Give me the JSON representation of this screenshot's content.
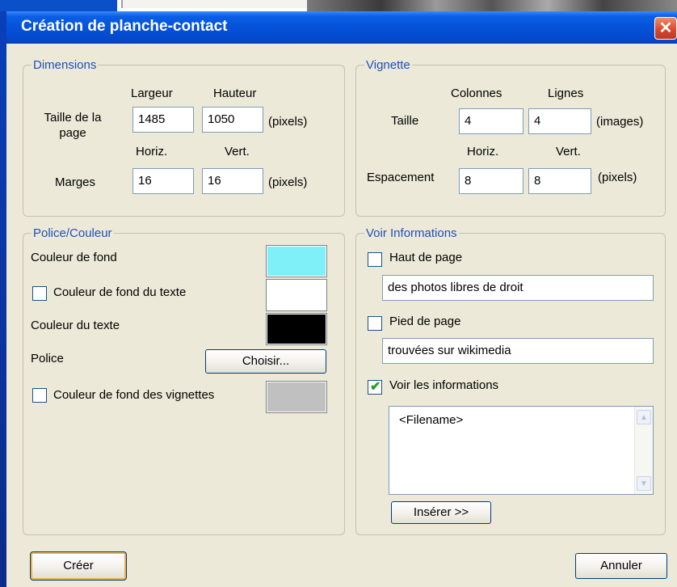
{
  "dialog": {
    "title": "Création de planche-contact",
    "close_icon": "close-icon"
  },
  "dimensions": {
    "legend": "Dimensions",
    "col_width": "Largeur",
    "col_height": "Hauteur",
    "page_size_label_line1": "Taille de la",
    "page_size_label_line2": "page",
    "page_width": "1485",
    "page_height": "1050",
    "units1": "(pixels)",
    "col_horiz": "Horiz.",
    "col_vert": "Vert.",
    "margins_label": "Marges",
    "margin_horiz": "16",
    "margin_vert": "16",
    "units2": "(pixels)"
  },
  "thumbnail": {
    "legend": "Vignette",
    "col_columns": "Colonnes",
    "col_rows": "Lignes",
    "size_label": "Taille",
    "columns": "4",
    "rows": "4",
    "units1": "(images)",
    "col_horiz": "Horiz.",
    "col_vert": "Vert.",
    "spacing_label": "Espacement",
    "spacing_horiz": "8",
    "spacing_vert": "8",
    "units2": "(pixels)"
  },
  "font_color": {
    "legend": "Police/Couleur",
    "bg_color_label": "Couleur de fond",
    "bg_color": "#80f0f8",
    "text_bg_label": "Couleur de fond du texte",
    "text_bg_checked": false,
    "text_bg_color": "#ffffff",
    "text_color_label": "Couleur du texte",
    "text_color": "#000000",
    "font_label": "Police",
    "choose_button": "Choisir...",
    "thumb_bg_label": "Couleur de fond des vignettes",
    "thumb_bg_checked": false,
    "thumb_bg_color": "#c0c0c0"
  },
  "info": {
    "legend": "Voir Informations",
    "header_label": "Haut de page",
    "header_checked": false,
    "header_value": "des photos libres de droit",
    "footer_label": "Pied de page",
    "footer_checked": false,
    "footer_value": "trouvées sur wikimedia",
    "show_info_label": "Voir les informations",
    "show_info_checked": true,
    "info_template": "<Filename>",
    "insert_button": "Insérer >>"
  },
  "actions": {
    "create": "Créer",
    "cancel": "Annuler"
  }
}
